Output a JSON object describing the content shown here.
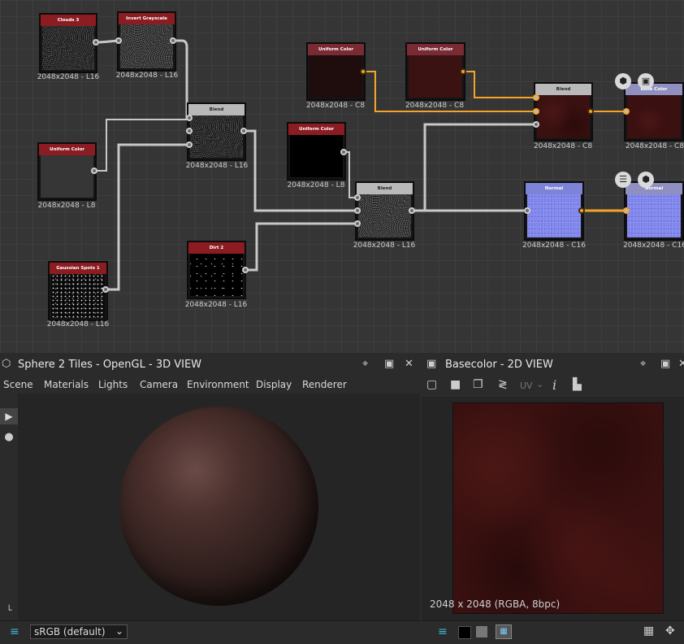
{
  "nodes": {
    "clouds3": {
      "title": "Clouds 3",
      "size": "2048x2048 - L16"
    },
    "invert": {
      "title": "Invert Grayscale",
      "size": "2048x2048 - L16"
    },
    "blend1": {
      "title": "Blend",
      "size": "2048x2048 - L16"
    },
    "uniform_left": {
      "title": "Uniform Color",
      "size": "2048x2048 - L8"
    },
    "gauss": {
      "title": "Gaussian Spots 1",
      "size": "2048x2048 - L16"
    },
    "dirt2": {
      "title": "Dirt 2",
      "size": "2048x2048 - L16"
    },
    "uniform_black": {
      "title": "Uniform Color",
      "size": "2048x2048 - L8"
    },
    "blend2": {
      "title": "Blend",
      "size": "2048x2048 - L16"
    },
    "uniform_c1": {
      "title": "Uniform Color",
      "size": "2048x2048 - C8"
    },
    "uniform_c2": {
      "title": "Uniform Color",
      "size": "2048x2048 - C8"
    },
    "blend3": {
      "title": "Blend",
      "size": "2048x2048 - C8"
    },
    "basecolor": {
      "title": "Base Color",
      "size": "2048x2048 - C8"
    },
    "normal_node": {
      "title": "Normal",
      "size": "2048x2048 - C16"
    },
    "normal_out": {
      "title": "Normal",
      "size": "2048x2048 - C16"
    }
  },
  "view3d": {
    "title": "Sphere 2 Tiles - OpenGL - 3D VIEW",
    "menu": [
      "Scene",
      "Materials",
      "Lights",
      "Camera",
      "Environment",
      "Display",
      "Renderer"
    ],
    "colorspace": "sRGB (default)"
  },
  "view2d": {
    "title": "Basecolor - 2D VIEW",
    "uv_label": "UV",
    "info": "2048 x 2048 (RGBA, 8bpc)"
  },
  "colors": {
    "graph_bg": "#353535",
    "accent_orange": "#f4a428",
    "node_header_red": "#8b1c22",
    "normal_blue": "#7d84d8"
  }
}
